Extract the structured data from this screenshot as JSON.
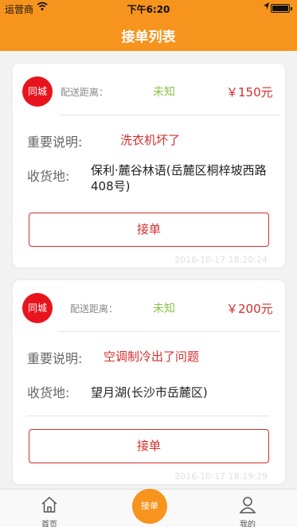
{
  "status_bar": {
    "carrier": "运营商",
    "time": "下午6:20"
  },
  "nav": {
    "title": "接单列表"
  },
  "orders": [
    {
      "badge": "同城",
      "distance_label": "配送距离：",
      "distance_value": "未知",
      "price": "￥150元",
      "note_label": "重要说明:",
      "note": "洗衣机坏了",
      "address_label": "收货地:",
      "address_line1": "保利·麓谷林语(岳麓区桐梓坡西路",
      "address_line2": "408号)",
      "accept_label": "接单",
      "timestamp": "2016-10-17 18:20:24"
    },
    {
      "badge": "同城",
      "distance_label": "配送距离：",
      "distance_value": "未知",
      "price": "￥200元",
      "note_label": "重要说明:",
      "note": "空调制冷出了问题",
      "address_label": "收货地:",
      "address_line1": "望月湖(长沙市岳麓区)",
      "accept_label": "接单",
      "timestamp": "2016-10-17 18:19:29"
    }
  ],
  "tab_bar": {
    "home": "首页",
    "center": "接单",
    "mine": "我的"
  },
  "colors": {
    "brand_orange": "#f7941d",
    "badge_red": "#e8141d",
    "price_red": "#d32f2f",
    "status_green": "#8bc34a"
  }
}
